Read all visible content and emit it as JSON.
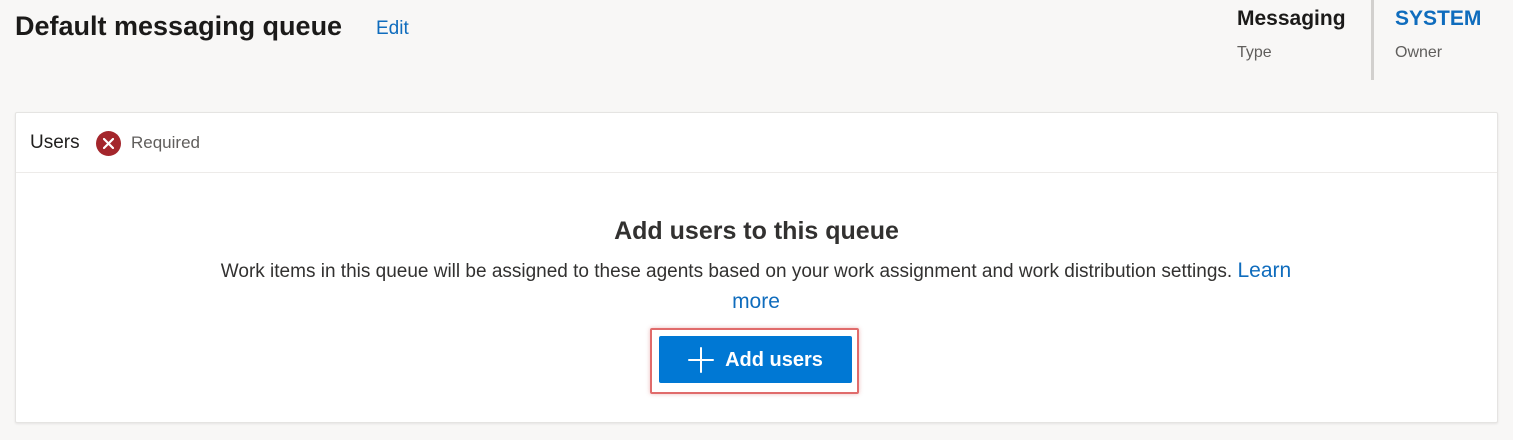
{
  "header": {
    "title": "Default messaging queue",
    "edit_label": "Edit",
    "type": {
      "value": "Messaging",
      "label": "Type"
    },
    "owner": {
      "value": "SYSTEM",
      "label": "Owner"
    }
  },
  "users_section": {
    "title": "Users",
    "required_icon": "close-circle-icon",
    "required_label": "Required",
    "empty_state": {
      "title": "Add users to this queue",
      "description": "Work items in this queue will be assigned to these agents based on your work assignment and work distribution settings.",
      "learn_more": "Learn more",
      "button_icon": "plus-icon",
      "button_label": "Add users"
    }
  },
  "colors": {
    "accent": "#0078d4",
    "link": "#0f6cbd",
    "required": "#a4262c",
    "highlight": "#e06b6b"
  }
}
